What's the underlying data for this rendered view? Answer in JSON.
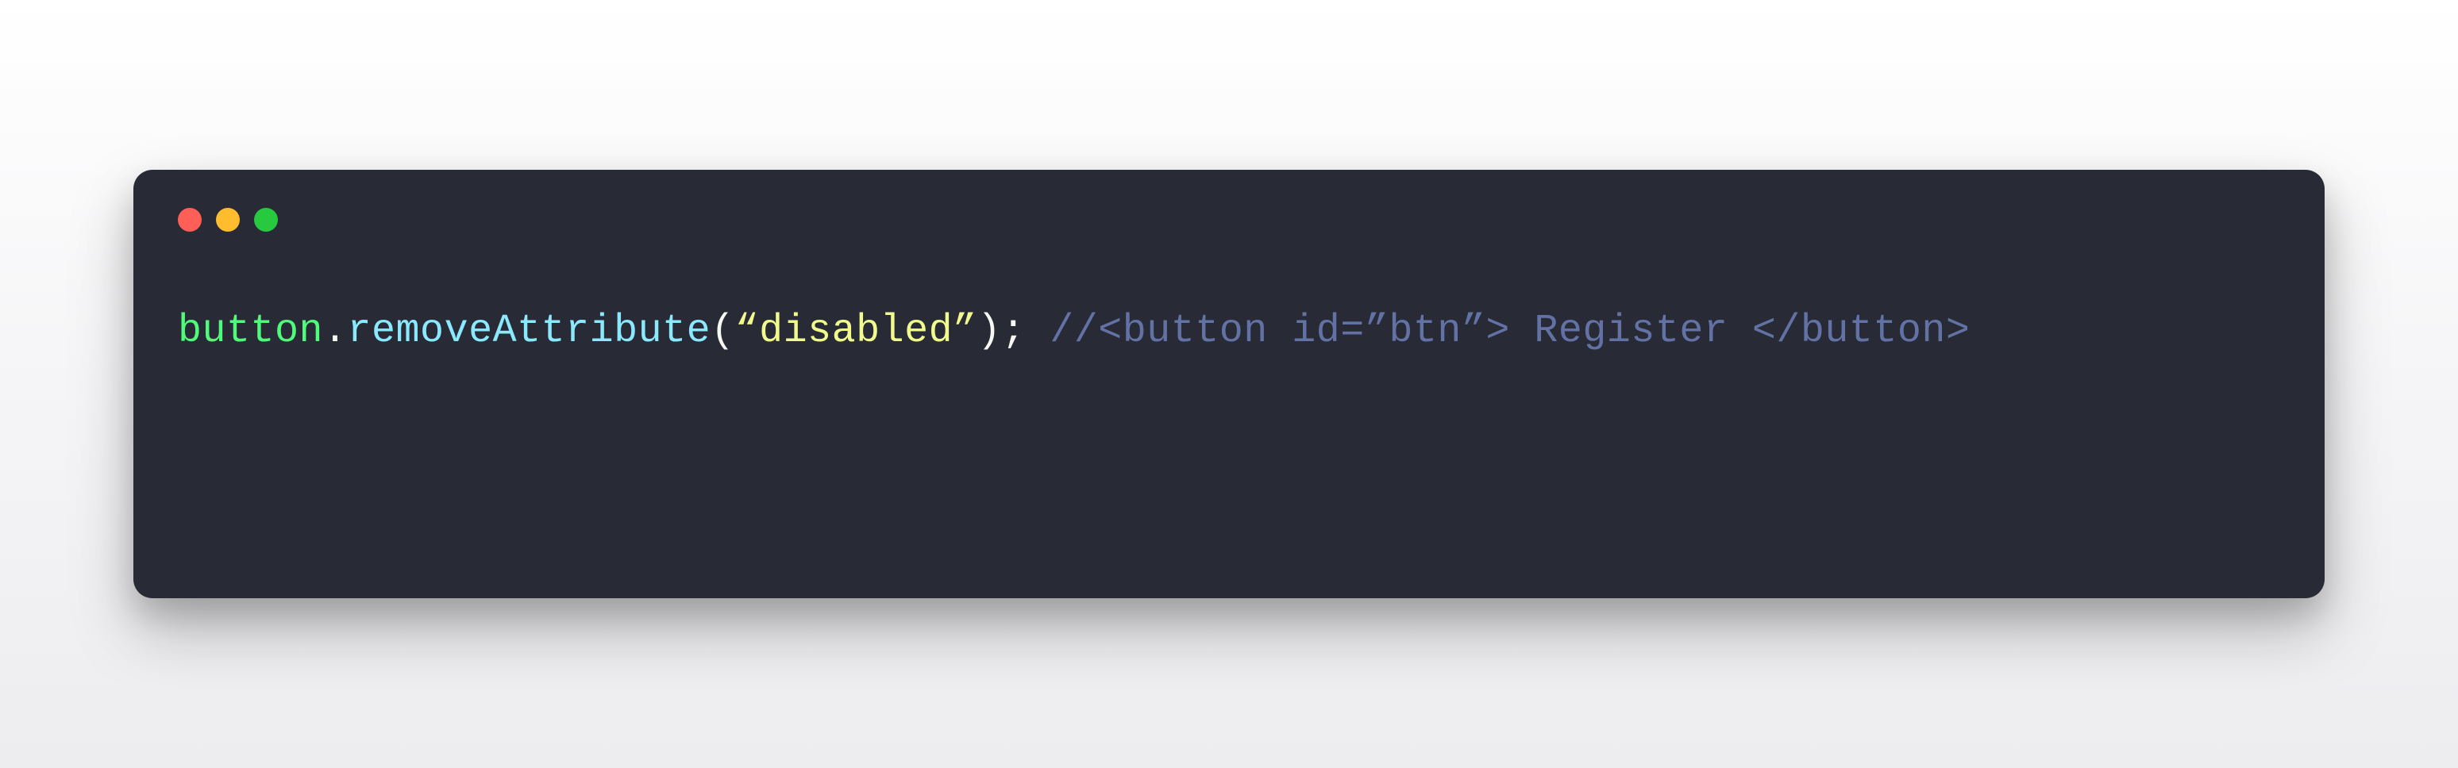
{
  "window": {
    "controls": {
      "close": "close",
      "minimize": "minimize",
      "maximize": "maximize"
    }
  },
  "code": {
    "tokens": {
      "identifier": "button",
      "dot": ".",
      "method": "removeAttribute",
      "paren_open": "(",
      "string": "“disabled”",
      "paren_close": ")",
      "semicolon": ";",
      "space": " ",
      "comment": "//<button id=”btn”> Register </button>"
    }
  },
  "colors": {
    "background": "#282a36",
    "identifier": "#50fa7b",
    "punctuation": "#f8f8f2",
    "method": "#8be9fd",
    "string": "#f1fa8c",
    "comment": "#6272a4",
    "dot_red": "#ff5f56",
    "dot_yellow": "#ffbd2e",
    "dot_green": "#27c93f"
  }
}
